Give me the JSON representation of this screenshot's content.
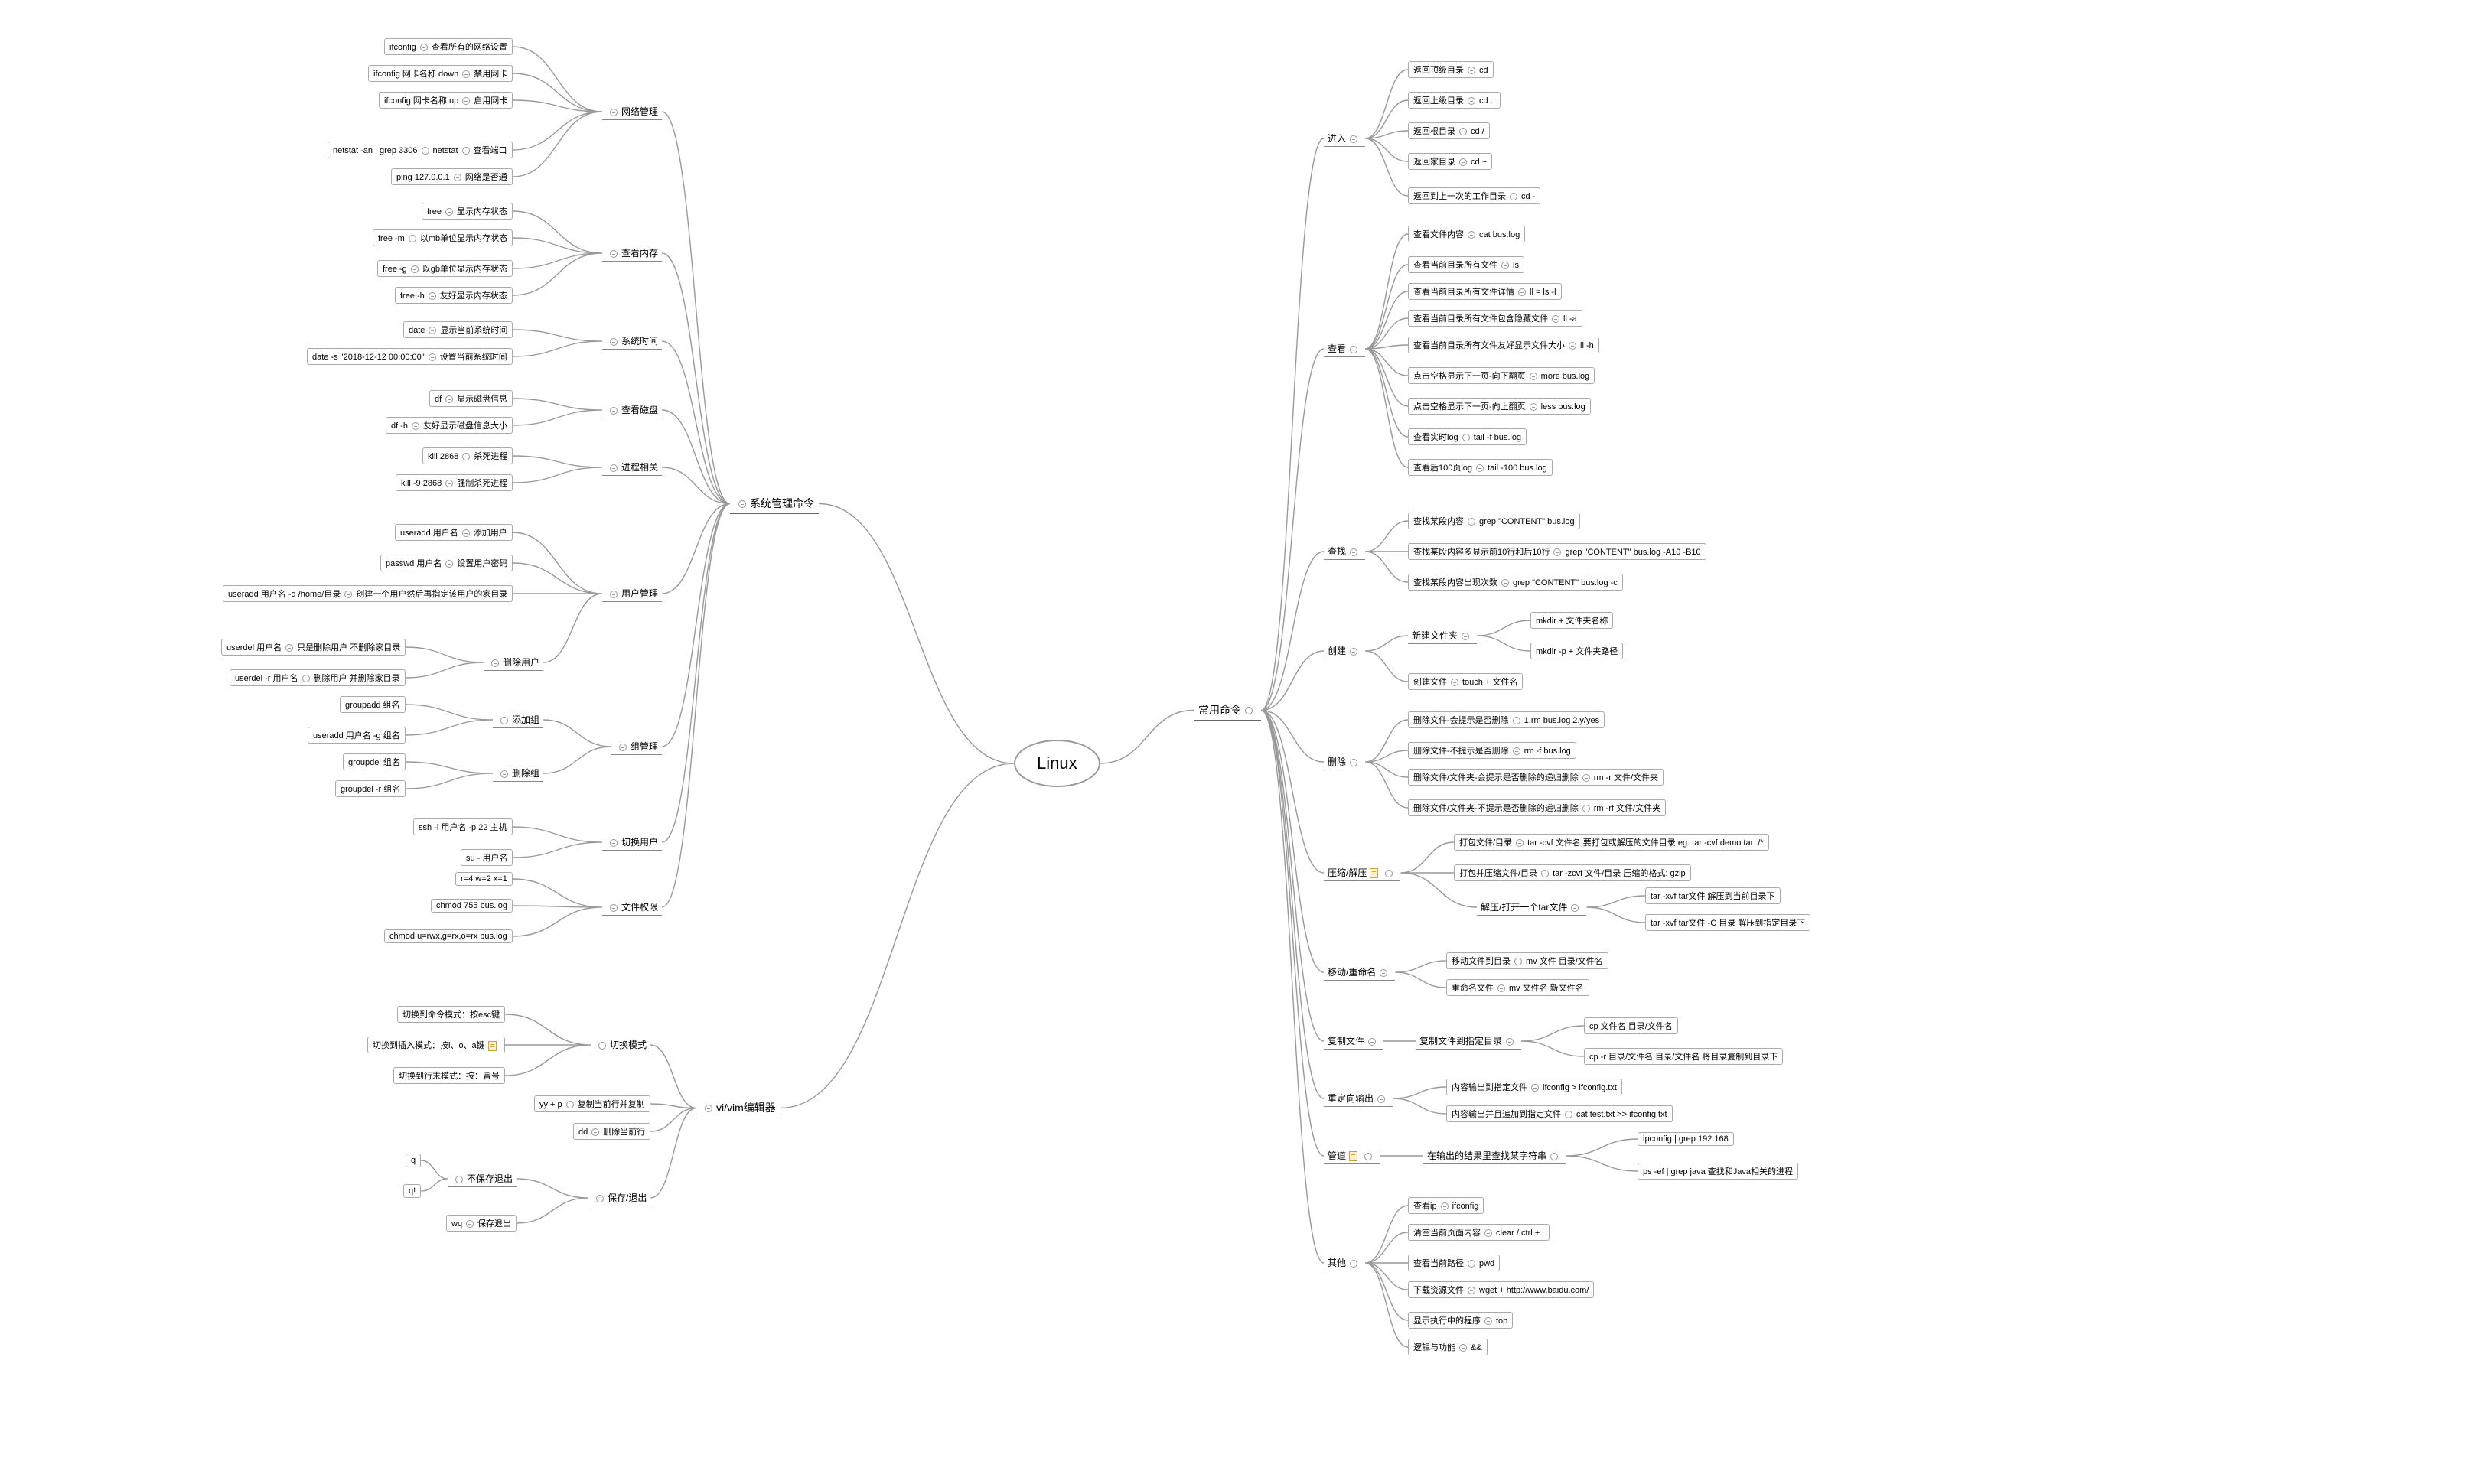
{
  "root": "Linux",
  "sys": {
    "label": "系统管理命令",
    "net": {
      "label": "网络管理",
      "k0": "ifconfig",
      "d0": "查看所有的网络设置",
      "k1": "ifconfig 网卡名称 down",
      "d1": "禁用网卡",
      "k2": "ifconfig 网卡名称 up",
      "d2": "启用网卡",
      "k3": "netstat -an | grep 3306",
      "d3n": "netstat",
      "d3": "查看端口",
      "k4": "ping 127.0.0.1",
      "d4": "网络是否通"
    },
    "mem": {
      "label": "查看内存",
      "k0": "free",
      "d0": "显示内存状态",
      "k1": "free -m",
      "d1": "以mb单位显示内存状态",
      "k2": "free -g",
      "d2": "以gb单位显示内存状态",
      "k3": "free -h",
      "d3": "友好显示内存状态"
    },
    "time": {
      "label": "系统时间",
      "k0": "date",
      "d0": "显示当前系统时间",
      "k1": "date -s \"2018-12-12 00:00:00\"",
      "d1": "设置当前系统时间"
    },
    "disk": {
      "label": "查看磁盘",
      "k0": "df",
      "d0": "显示磁盘信息",
      "k1": "df -h",
      "d1": "友好显示磁盘信息大小"
    },
    "proc": {
      "label": "进程相关",
      "k0": "kill 2868",
      "d0": "杀死进程",
      "k1": "kill -9 2868",
      "d1": "强制杀死进程"
    },
    "user": {
      "label": "用户管理",
      "k0": "useradd 用户名",
      "d0": "添加用户",
      "k1": "passwd 用户名",
      "d1": "设置用户密码",
      "k2": "useradd 用户名 -d /home/目录",
      "d2": "创建一个用户然后再指定该用户的家目录",
      "del": {
        "label": "删除用户",
        "k0": "userdel 用户名",
        "d0": "只是删除用户 不删除家目录",
        "k1": "userdel -r 用户名",
        "d1": "删除用户 并删除家目录"
      }
    },
    "group": {
      "label": "组管理",
      "add": {
        "label": "添加组",
        "k0": "groupadd 组名",
        "k1": "useradd 用户名 -g 组名"
      },
      "del": {
        "label": "删除组",
        "k0": "groupdel 组名",
        "k1": "groupdel -r 组名"
      }
    },
    "su": {
      "label": "切换用户",
      "k0": "ssh -l 用户名 -p 22 主机",
      "k1": "su - 用户名"
    },
    "perm": {
      "label": "文件权限",
      "k0": "r=4 w=2 x=1",
      "k1": "chmod 755  bus.log",
      "k2": "chmod u=rwx,g=rx,o=rx bus.log"
    }
  },
  "vi": {
    "label": "vi/vim编辑器",
    "mode": {
      "label": "切换模式",
      "k0": "切换到命令模式：按esc键",
      "k1": "切换到插入模式：按i、o、a键",
      "k2": "切换到行末模式：按：冒号"
    },
    "yy": {
      "k": "yy + p",
      "d": "复制当前行并复制"
    },
    "dd": {
      "k": "dd",
      "d": "删除当前行"
    },
    "save": {
      "label": "保存/退出",
      "no": {
        "label": "不保存退出",
        "k0": "q",
        "k1": "q!"
      },
      "yes": {
        "k": "wq",
        "d": "保存退出"
      }
    }
  },
  "cmd": {
    "label": "常用命令",
    "cd": {
      "label": "进入",
      "d0": "返回顶级目录",
      "k0": "cd",
      "d1": "返回上级目录",
      "k1": "cd ..",
      "d2": "返回根目录",
      "k2": "cd /",
      "d3": "返回家目录",
      "k3": "cd ~",
      "d4": "返回到上一次的工作目录",
      "k4": "cd -"
    },
    "view": {
      "label": "查看",
      "d0": "查看文件内容",
      "k0": "cat bus.log",
      "d1": "查看当前目录所有文件",
      "k1": "ls",
      "d2": "查看当前目录所有文件详情",
      "k2": "ll = ls -l",
      "d3": "查看当前目录所有文件包含隐藏文件",
      "k3": "ll -a",
      "d4": "查看当前目录所有文件友好显示文件大小",
      "k4": "ll -h",
      "d5": "点击空格显示下一页-向下翻页",
      "k5": "more bus.log",
      "d6": "点击空格显示下一页-向上翻页",
      "k6": "less bus.log",
      "d7": "查看实时log",
      "k7": "tail -f bus.log",
      "d8": "查看后100页log",
      "k8": "tail -100 bus.log"
    },
    "find": {
      "label": "查找",
      "d0": "查找某段内容",
      "k0": "grep \"CONTENT\" bus.log",
      "d1": "查找某段内容多显示前10行和后10行",
      "k1": "grep \"CONTENT\" bus.log -A10 -B10",
      "d2": "查找某段内容出现次数",
      "k2": "grep \"CONTENT\" bus.log -c"
    },
    "create": {
      "label": "创建",
      "folder": {
        "label": "新建文件夹",
        "k0": "mkdir + 文件夹名称",
        "k1": "mkdir -p + 文件夹路径"
      },
      "d1": "创建文件",
      "k1": "touch + 文件名"
    },
    "rm": {
      "label": "删除",
      "d0": "删除文件-会提示是否删除",
      "k0": "1.rm bus.log 2.y/yes",
      "d1": "删除文件-不提示是否删除",
      "k1": "rm -f bus.log",
      "d2": "删除文件/文件夹-会提示是否删除的递归删除",
      "k2": "rm -r 文件/文件夹",
      "d3": "删除文件/文件夹-不提示是否删除的递归删除",
      "k3": "rm -rf 文件/文件夹"
    },
    "tar": {
      "label": "压缩/解压",
      "d0": "打包文件/目录",
      "k0": "tar -cvf 文件名 要打包或解压的文件目录 eg. tar -cvf demo.tar ./*",
      "d1": "打包并压缩文件/目录",
      "k1": "tar -zcvf 文件/目录 压缩的格式: gzip",
      "un": {
        "label": "解压/打开一个tar文件",
        "k0": "tar -xvf tar文件 解压到当前目录下",
        "k1": "tar -xvf tar文件 -C 目录 解压到指定目录下"
      }
    },
    "mv": {
      "label": "移动/重命名",
      "d0": "移动文件到目录",
      "k0": "mv 文件 目录/文件名",
      "d1": "重命名文件",
      "k1": "mv 文件名 新文件名"
    },
    "cp": {
      "label": "复制文件",
      "sub": "复制文件到指定目录",
      "k0": "cp 文件名 目录/文件名",
      "k1": "cp -r 目录/文件名 目录/文件名 将目录复制到目录下"
    },
    "redir": {
      "label": "重定向输出",
      "d0": "内容输出到指定文件",
      "k0": "ifconfig > ifconfig.txt",
      "d1": "内容输出并且追加到指定文件",
      "k1": "cat test.txt >> ifconfig.txt"
    },
    "pipe": {
      "label": "管道",
      "sub": "在输出的结果里查找某字符串",
      "k0": "ipconfig | grep 192.168",
      "k1": "ps -ef | grep java 查找和Java相关的进程"
    },
    "other": {
      "label": "其他",
      "d0": "查看ip",
      "k0": "ifconfig",
      "d1": "清空当前页面内容",
      "k1": "clear / ctrl + l",
      "d2": "查看当前路径",
      "k2": "pwd",
      "d3": "下载资源文件",
      "k3": "wget + http://www.baidu.com/",
      "d4": "显示执行中的程序",
      "k4": "top",
      "d5": "逻辑与功能",
      "k5": "&&"
    }
  }
}
